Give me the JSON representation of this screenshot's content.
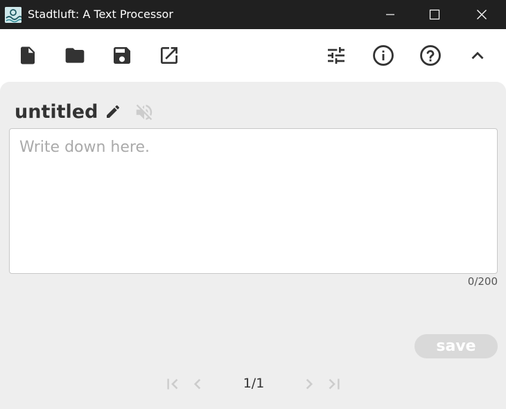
{
  "window": {
    "title": "Stadtluft: A Text Processor",
    "icon": "app-logo-icon",
    "controls": [
      "minimize-icon",
      "maximize-icon",
      "close-icon"
    ]
  },
  "toolbar": {
    "left": [
      "new-file-icon",
      "open-folder-icon",
      "save-icon",
      "open-in-new-icon"
    ],
    "right": [
      "settings-tune-icon",
      "info-icon",
      "help-icon",
      "collapse-chevron-icon"
    ]
  },
  "document": {
    "title": "untitled",
    "editor": {
      "value": "",
      "placeholder": "Write down here."
    },
    "counter": {
      "current": "0",
      "max": "/200"
    },
    "save_label": "save"
  },
  "pagination": {
    "label": "1/1"
  },
  "colors": {
    "titlebar": "#202020",
    "panel": "#eeeeee",
    "icon": "#333333",
    "disabled": "#cccccc",
    "save_button": "#d9d9d9"
  }
}
